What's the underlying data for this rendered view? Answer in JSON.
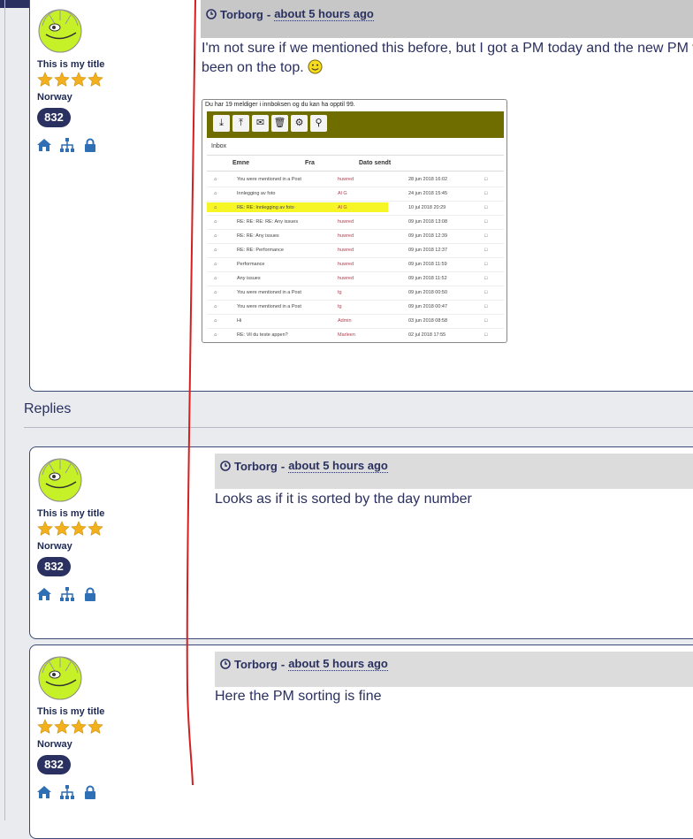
{
  "main_post": {
    "author": "Torborg",
    "time": "about 5 hours ago",
    "text_line1": "I'm not sure if we mentioned this before, but I got a PM today and the new PM w",
    "text_line2": "been on the top.",
    "profile": {
      "title": "This is my title",
      "country": "Norway",
      "count": "832"
    },
    "screenshot": {
      "caption": "Du har 19 meldiger i innboksen og du kan ha opptil 99.",
      "inbox_label": "Inbox",
      "columns": [
        "Emne",
        "Fra",
        "Dato sendt"
      ],
      "rows": [
        {
          "subject": "You were mentioned in a Post",
          "from": "huwred",
          "date": "28 jun 2018 16:02"
        },
        {
          "subject": "Innlegging av foto",
          "from": "Al G",
          "date": "24 jun 2018 15:45"
        },
        {
          "subject": "RE: RE: Innlegging av foto",
          "from": "Al G",
          "date": "10 jul 2018 20:29"
        },
        {
          "subject": "RE: RE: RE: RE: Any issues",
          "from": "huwred",
          "date": "09 jun 2018 13:08"
        },
        {
          "subject": "RE: RE: Any issues",
          "from": "huwred",
          "date": "09 jun 2018 12:39"
        },
        {
          "subject": "RE: RE: Performance",
          "from": "huwred",
          "date": "09 jun 2018 12:37"
        },
        {
          "subject": "Performance",
          "from": "huwred",
          "date": "09 jun 2018 11:59"
        },
        {
          "subject": "Any issues",
          "from": "huwred",
          "date": "09 jun 2018 11:52"
        },
        {
          "subject": "You were mentioned in a Post",
          "from": "tg",
          "date": "09 jun 2018 00:50"
        },
        {
          "subject": "You were mentioned in a Post",
          "from": "tg",
          "date": "09 jun 2018 00:47"
        },
        {
          "subject": "Hi",
          "from": "Admin",
          "date": "03 jun 2018 08:58"
        },
        {
          "subject": "RE: Vil du teste appen?",
          "from": "Marleen",
          "date": "02 jul 2018 17:55"
        }
      ]
    }
  },
  "replies_label": "Replies",
  "replies": [
    {
      "author": "Torborg",
      "time": "about 5 hours ago",
      "text": "Looks as if it is sorted by the day number",
      "profile": {
        "title": "This is my title",
        "country": "Norway",
        "count": "832"
      }
    },
    {
      "author": "Torborg",
      "time": "about 5 hours ago",
      "text": "Here the PM sorting is fine",
      "profile": {
        "title": "This is my title",
        "country": "Norway",
        "count": "832"
      }
    }
  ],
  "colors": {
    "navy": "#2a3060",
    "header_gray": "#dcdcdc",
    "annotation_red": "#d42020",
    "highlight": "#f5f500",
    "toolbar": "#6f6c00"
  },
  "icons": [
    "clock-icon",
    "home-icon",
    "sitemap-icon",
    "lock-icon",
    "star-icon",
    "smiley-icon"
  ]
}
